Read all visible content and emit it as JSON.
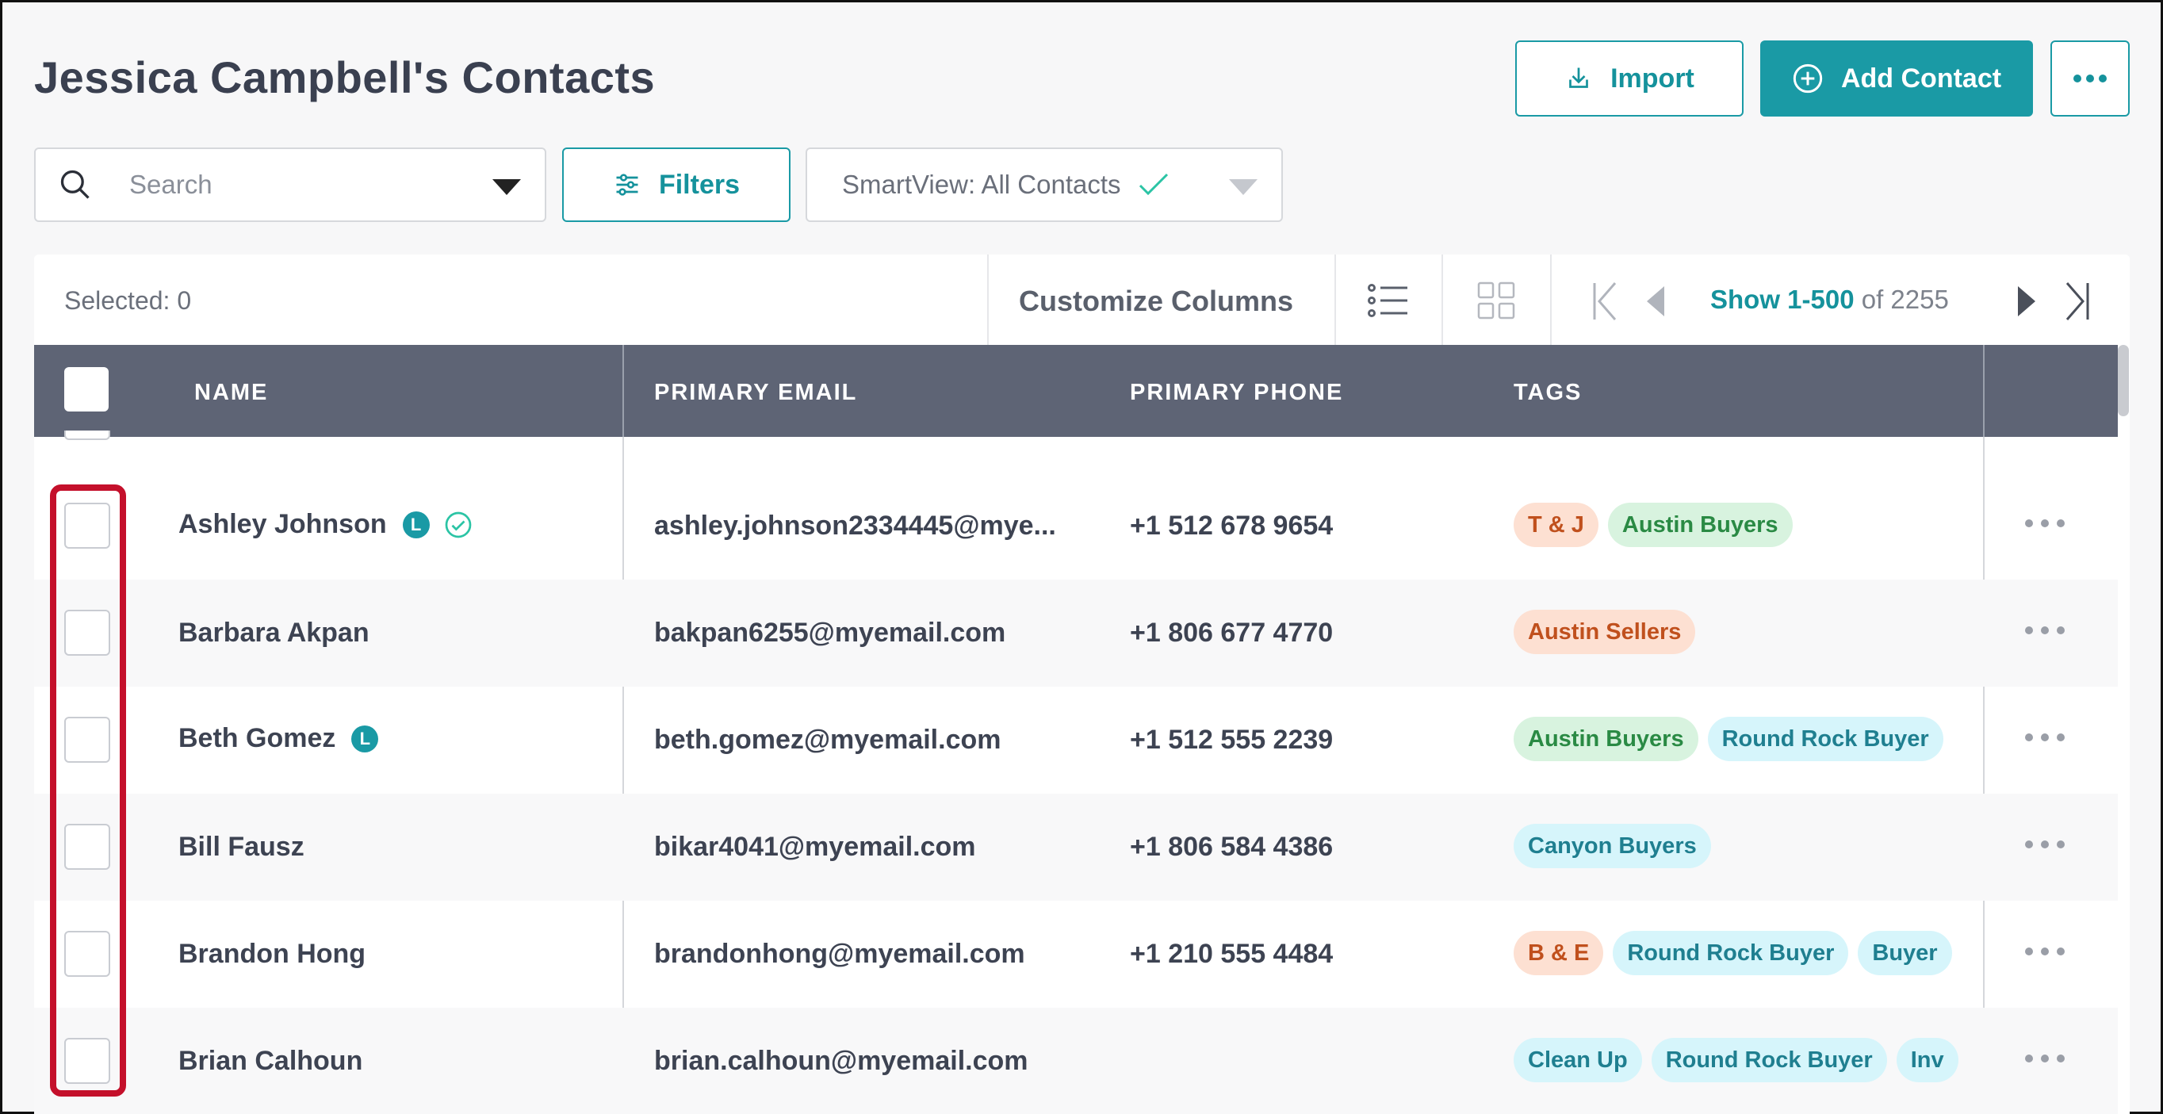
{
  "page": {
    "title": "Jessica Campbell's Contacts",
    "import_label": "Import",
    "add_contact_label": "Add Contact",
    "more_icon": "ellipsis-icon"
  },
  "search": {
    "placeholder": "Search",
    "value": ""
  },
  "filters_label": "Filters",
  "smartview": {
    "label": "SmartView: All Contacts"
  },
  "toolbar": {
    "selected": "Selected: 0",
    "customize_columns": "Customize Columns",
    "list_view_icon": "list-view-icon",
    "grid_view_icon": "grid-view-icon",
    "pager_range": "Show 1-500",
    "pager_total": " of 2255"
  },
  "columns": {
    "name": "NAME",
    "email": "PRIMARY EMAIL",
    "phone": "PRIMARY PHONE",
    "tags": "TAGS"
  },
  "rows": [
    {
      "name": "Ashley Johnson",
      "lead_badge": "L",
      "verified": true,
      "email": "ashley.johnson2334445@mye...",
      "phone": "+1 512 678 9654",
      "tags": [
        {
          "label": "T & J",
          "color": "orange"
        },
        {
          "label": "Austin Buyers",
          "color": "green"
        }
      ]
    },
    {
      "name": "Barbara Akpan",
      "email": "bakpan6255@myemail.com",
      "phone": "+1 806 677 4770",
      "tags": [
        {
          "label": "Austin Sellers",
          "color": "orange"
        }
      ]
    },
    {
      "name": "Beth Gomez",
      "lead_badge": "L",
      "email": "beth.gomez@myemail.com",
      "phone": "+1 512 555 2239",
      "tags": [
        {
          "label": "Austin Buyers",
          "color": "green"
        },
        {
          "label": "Round Rock Buyer",
          "color": "blue"
        }
      ]
    },
    {
      "name": "Bill Fausz",
      "email": "bikar4041@myemail.com",
      "phone": "+1 806 584 4386",
      "tags": [
        {
          "label": "Canyon Buyers",
          "color": "blue"
        }
      ]
    },
    {
      "name": "Brandon Hong",
      "email": "brandonhong@myemail.com",
      "phone": "+1 210 555 4484",
      "tags": [
        {
          "label": "B & E",
          "color": "orange"
        },
        {
          "label": "Round Rock Buyer",
          "color": "blue"
        },
        {
          "label": "Buyer",
          "color": "blue"
        }
      ]
    },
    {
      "name": "Brian Calhoun",
      "email": "brian.calhoun@myemail.com",
      "phone": "",
      "tags": [
        {
          "label": "Clean Up",
          "color": "blue"
        },
        {
          "label": "Round Rock Buyer",
          "color": "blue"
        },
        {
          "label": "Inv",
          "color": "blue"
        }
      ]
    }
  ],
  "colors": {
    "accent": "#1a9aa5",
    "header_bg": "#5e6475",
    "highlight": "#c4102b"
  }
}
